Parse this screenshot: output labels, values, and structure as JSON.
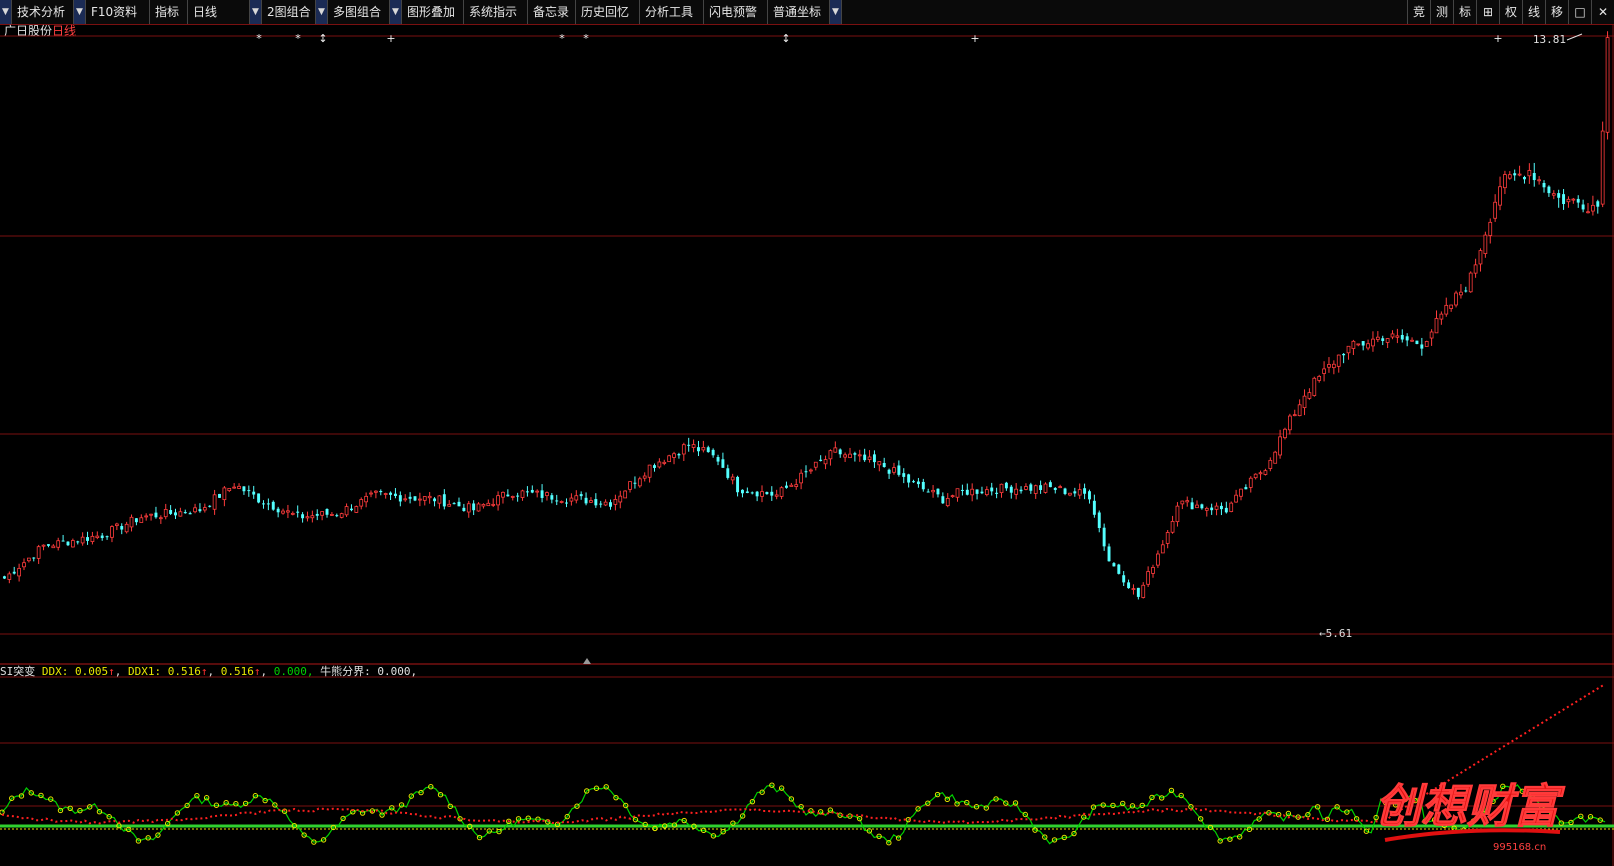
{
  "toolbar": {
    "items": [
      "技术分析",
      "F10资料",
      "指标",
      "日线",
      "2图组合",
      "多图组合",
      "图形叠加",
      "系统指示",
      "备忘录",
      "历史回忆",
      "分析工具",
      "闪电预警",
      "普通坐标"
    ],
    "right_buttons": [
      "竞",
      "测",
      "标",
      "⊞",
      "权",
      "线",
      "移",
      "□",
      "✕"
    ]
  },
  "stock": {
    "name": "广日股份",
    "period": "日线"
  },
  "price_labels": {
    "high": "13.81",
    "low": "5.61"
  },
  "indicator": {
    "name": "SI突变",
    "ddx_label": "DDX:",
    "ddx_value": "0.005",
    "ddx1_label": "DDX1:",
    "ddx1_value": "0.516",
    "v3": "0.516",
    "v4": "0.000,",
    "bull_bear_label": "牛熊分界:",
    "bull_bear_value": "0.000,"
  },
  "markers": [
    "*",
    "*",
    "↕",
    "+",
    "*",
    "*",
    "↕",
    "+",
    "+"
  ],
  "watermark": {
    "brand": "创想财富",
    "url": "995168.cn"
  },
  "colors": {
    "up": "#ff3c3c",
    "down": "#54ffff",
    "grid": "#7a1010",
    "ddx_yellow": "#e8e800",
    "ddx_green": "#00d200",
    "ddx1_red": "#ff2020"
  },
  "chart_data": {
    "type": "candlestick",
    "description_series": "daily price; prices in CNY",
    "price_range": [
      5.61,
      13.81
    ],
    "close_keypoints": [
      [
        0,
        6.35
      ],
      [
        8,
        6.8
      ],
      [
        20,
        6.95
      ],
      [
        28,
        7.2
      ],
      [
        40,
        7.3
      ],
      [
        47,
        7.65
      ],
      [
        52,
        7.45
      ],
      [
        60,
        7.2
      ],
      [
        68,
        7.25
      ],
      [
        76,
        7.5
      ],
      [
        88,
        7.45
      ],
      [
        96,
        7.3
      ],
      [
        104,
        7.55
      ],
      [
        110,
        7.5
      ],
      [
        124,
        7.4
      ],
      [
        132,
        7.9
      ],
      [
        140,
        8.2
      ],
      [
        146,
        8.0
      ],
      [
        150,
        7.6
      ],
      [
        158,
        7.5
      ],
      [
        170,
        8.1
      ],
      [
        180,
        7.9
      ],
      [
        186,
        7.65
      ],
      [
        192,
        7.45
      ],
      [
        196,
        7.55
      ],
      [
        206,
        7.6
      ],
      [
        214,
        7.6
      ],
      [
        222,
        7.5
      ],
      [
        226,
        6.6
      ],
      [
        232,
        6.1
      ],
      [
        238,
        7.0
      ],
      [
        240,
        7.4
      ],
      [
        250,
        7.3
      ],
      [
        258,
        7.9
      ],
      [
        266,
        8.9
      ],
      [
        274,
        9.5
      ],
      [
        282,
        9.7
      ],
      [
        290,
        9.6
      ],
      [
        300,
        10.5
      ],
      [
        306,
        11.8
      ],
      [
        312,
        12.0
      ],
      [
        318,
        11.6
      ],
      [
        326,
        11.5
      ],
      [
        328,
        13.8
      ]
    ]
  }
}
